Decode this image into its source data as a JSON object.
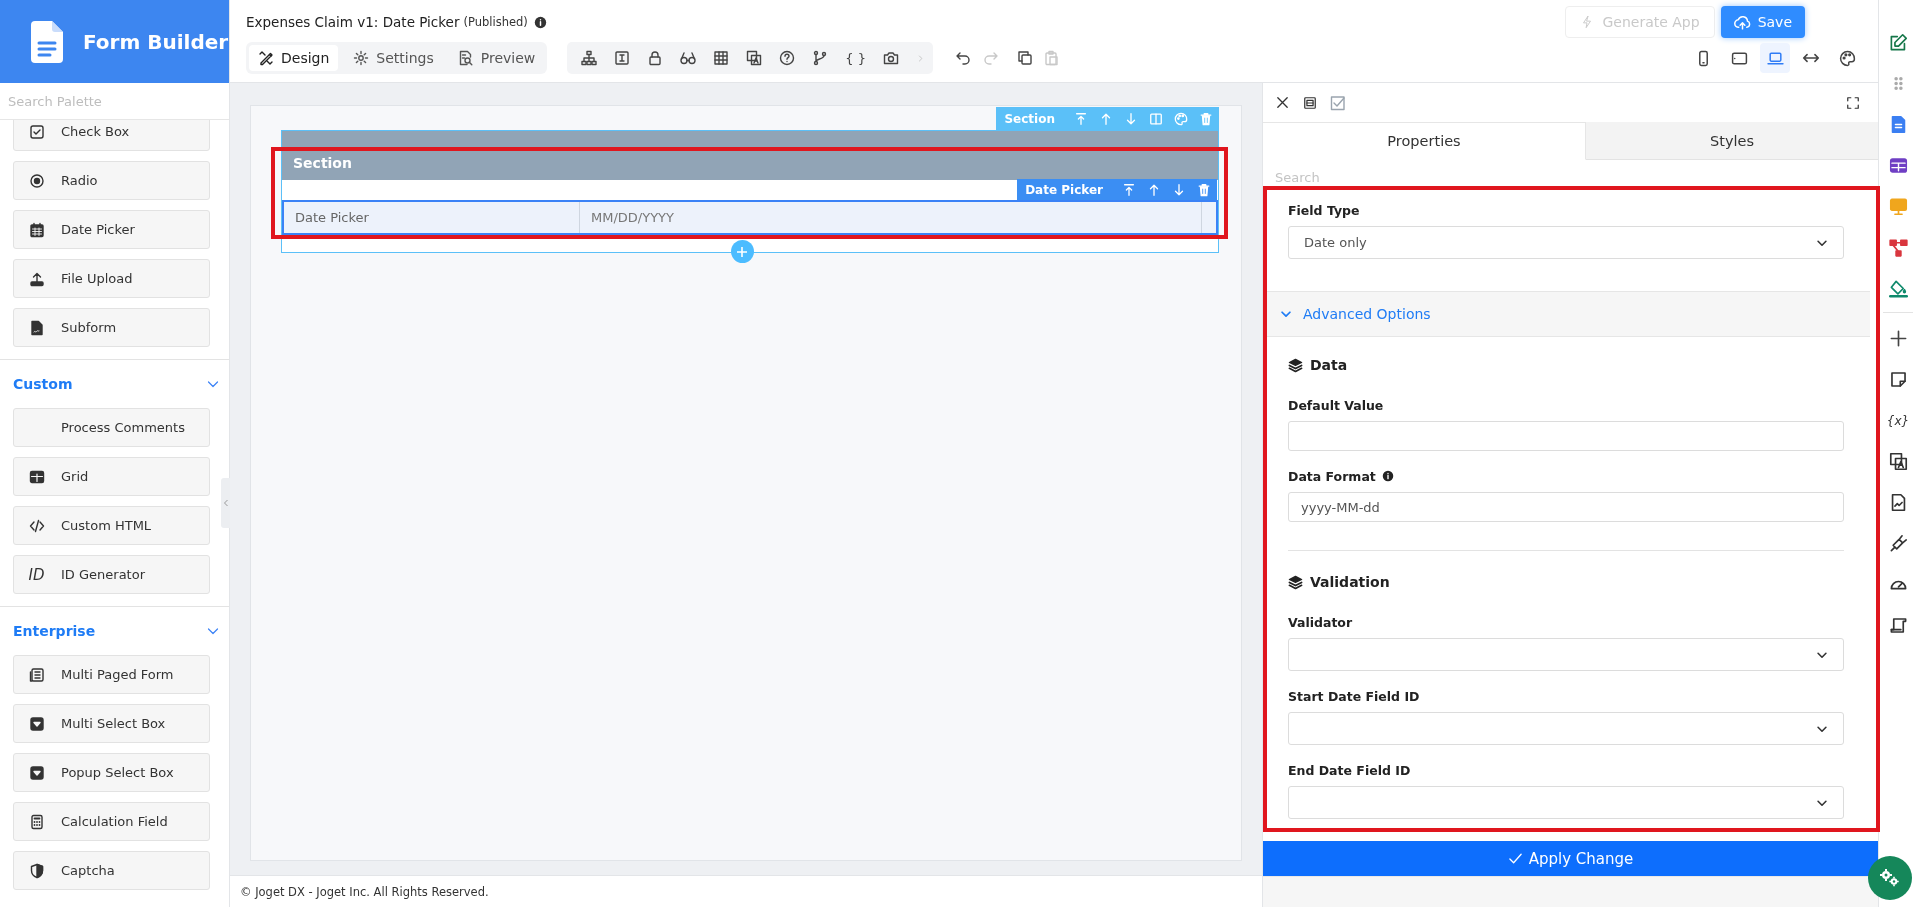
{
  "app": {
    "title": "Form Builder"
  },
  "palette": {
    "search_placeholder": "Search Palette",
    "items": [
      {
        "label": "Check Box"
      },
      {
        "label": "Radio"
      },
      {
        "label": "Date Picker"
      },
      {
        "label": "File Upload"
      },
      {
        "label": "Subform"
      }
    ],
    "groups": [
      {
        "title": "Custom",
        "expanded": true,
        "items": [
          {
            "label": "Process Comments"
          },
          {
            "label": "Grid"
          },
          {
            "label": "Custom HTML"
          },
          {
            "label": "ID Generator",
            "glyph": "ID"
          }
        ]
      },
      {
        "title": "Enterprise",
        "expanded": true,
        "items": [
          {
            "label": "Multi Paged Form"
          },
          {
            "label": "Multi Select Box"
          },
          {
            "label": "Popup Select Box"
          },
          {
            "label": "Calculation Field"
          },
          {
            "label": "Captcha"
          }
        ]
      }
    ]
  },
  "header": {
    "form_name": "Expenses Claim v1: Date Picker",
    "status": "(Published)"
  },
  "mode_tabs": [
    {
      "label": "Design",
      "selected": true
    },
    {
      "label": "Settings",
      "selected": false
    },
    {
      "label": "Preview",
      "selected": false
    }
  ],
  "toolbar": {
    "glyph": "{ }"
  },
  "history": [
    {
      "disabled": false
    },
    {
      "disabled": true
    }
  ],
  "clipboard": [
    {
      "disabled": false
    },
    {
      "disabled": true
    }
  ],
  "actions": {
    "generate_app": {
      "label": "Generate App",
      "disabled": true
    },
    "save": {
      "label": "Save"
    }
  },
  "devices": [
    {
      "selected": false
    },
    {
      "selected": false
    },
    {
      "selected": true
    }
  ],
  "canvas": {
    "section_toolbar": {
      "label": "Section"
    },
    "section": {
      "title": "Section"
    },
    "element_toolbar": {
      "label": "Date Picker"
    },
    "field": {
      "label": "Date Picker",
      "placeholder": "MM/DD/YYYY"
    }
  },
  "footer": {
    "text": "© Joget DX - Joget Inc. All Rights Reserved."
  },
  "properties": {
    "tabs": [
      {
        "label": "Properties",
        "selected": true
      },
      {
        "label": "Styles",
        "selected": false
      }
    ],
    "search_placeholder": "Search",
    "field_type": {
      "label": "Field Type",
      "value": "Date only"
    },
    "advanced": {
      "label": "Advanced Options",
      "expanded": true
    },
    "groups": [
      {
        "title": "Data",
        "fields": [
          {
            "kind": "text",
            "label": "Default Value",
            "info": false
          },
          {
            "kind": "text",
            "label": "Data Format",
            "info": true,
            "value": "yyyy-MM-dd"
          }
        ]
      },
      {
        "title": "Validation",
        "fields": [
          {
            "kind": "select",
            "label": "Validator",
            "info": false
          },
          {
            "kind": "select",
            "label": "Start Date Field ID",
            "info": false
          },
          {
            "kind": "select",
            "label": "End Date Field ID",
            "info": false
          }
        ]
      }
    ],
    "apply": {
      "label": "Apply Change"
    }
  },
  "rail": {
    "glyph": "{x}"
  }
}
